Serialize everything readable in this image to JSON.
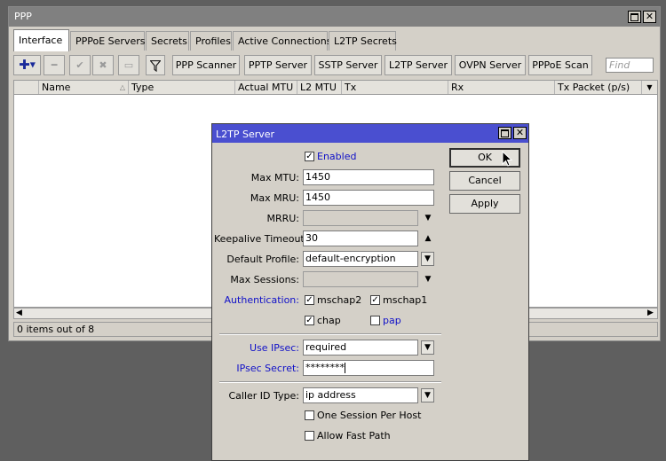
{
  "ppp_window": {
    "title": "PPP",
    "tabs": [
      {
        "label": "Interface",
        "active": true
      },
      {
        "label": "PPPoE Servers"
      },
      {
        "label": "Secrets"
      },
      {
        "label": "Profiles"
      },
      {
        "label": "Active Connections"
      },
      {
        "label": "L2TP Secrets"
      }
    ],
    "toolbar": {
      "add_icon": "plus-icon",
      "remove_icon": "minus-icon",
      "enable_icon": "check-icon",
      "disable_icon": "x-icon",
      "comment_icon": "comment-icon",
      "filter_icon": "filter-icon",
      "buttons": [
        "PPP Scanner",
        "PPTP Server",
        "SSTP Server",
        "L2TP Server",
        "OVPN Server",
        "PPPoE Scan"
      ],
      "find_placeholder": "Find"
    },
    "columns": [
      "Name",
      "Type",
      "Actual MTU",
      "L2 MTU",
      "Tx",
      "Rx",
      "Tx Packet (p/s)"
    ],
    "status": "0 items out of 8"
  },
  "dialog": {
    "title": "L2TP Server",
    "enabled_label": "Enabled",
    "enabled": true,
    "max_mtu_label": "Max MTU:",
    "max_mtu": "1450",
    "max_mru_label": "Max MRU:",
    "max_mru": "1450",
    "mrru_label": "MRRU:",
    "mrru": "",
    "keepalive_label": "Keepalive Timeout:",
    "keepalive": "30",
    "default_profile_label": "Default Profile:",
    "default_profile": "default-encryption",
    "max_sessions_label": "Max Sessions:",
    "max_sessions": "",
    "authentication_label": "Authentication:",
    "auth": {
      "mschap2": {
        "label": "mschap2",
        "checked": true
      },
      "mschap1": {
        "label": "mschap1",
        "checked": true
      },
      "chap": {
        "label": "chap",
        "checked": true
      },
      "pap": {
        "label": "pap",
        "checked": false
      }
    },
    "use_ipsec_label": "Use IPsec:",
    "use_ipsec": "required",
    "ipsec_secret_label": "IPsec Secret:",
    "ipsec_secret": "********",
    "caller_id_label": "Caller ID Type:",
    "caller_id": "ip address",
    "one_session_label": "One Session Per Host",
    "one_session": false,
    "allow_fast_path_label": "Allow Fast Path",
    "allow_fast_path": false,
    "ok_label": "OK",
    "cancel_label": "Cancel",
    "apply_label": "Apply"
  }
}
